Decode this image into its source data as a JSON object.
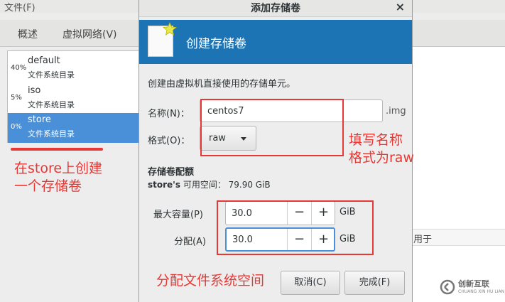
{
  "menubar": {
    "file": "文件(F)"
  },
  "tabs": {
    "overview": "概述",
    "network": "虚拟网络(V)"
  },
  "pools": [
    {
      "pct": "40%",
      "name": "default",
      "sub": "文件系统目录"
    },
    {
      "pct": "5%",
      "name": "iso",
      "sub": "文件系统目录"
    },
    {
      "pct": "0%",
      "name": "store",
      "sub": "文件系统目录"
    }
  ],
  "right_pane": {
    "row_text": "用于"
  },
  "dialog": {
    "title": "添加存储卷",
    "close": "×",
    "banner_title": "创建存储卷",
    "description": "创建由虚拟机直接使用的存储单元。",
    "name_label": "名称(N)：",
    "name_value": "centos7",
    "name_suffix": ".img",
    "format_label": "格式(O)：",
    "format_value": "raw",
    "section_title": "存储卷配额",
    "avail_pool": "store's",
    "avail_text": " 可用空间：  79.90 GiB",
    "max_label": "最大容量(P)",
    "max_value": "30.0",
    "alloc_label": "分配(A)",
    "alloc_value": "30.0",
    "minus": "−",
    "plus": "+",
    "unit": "GiB",
    "cancel": "取消(C)",
    "finish": "完成(F)"
  },
  "annotations": {
    "create_note_1": "在store上创建",
    "create_note_2": "一个存储卷",
    "name_note_1": "填写名称",
    "name_note_2": "格式为raw",
    "alloc_note": "分配文件系统空间",
    "accent": "#e53935"
  },
  "watermark": {
    "text": "创新互联",
    "sub": "CHUANG XIN HU LIAN"
  }
}
